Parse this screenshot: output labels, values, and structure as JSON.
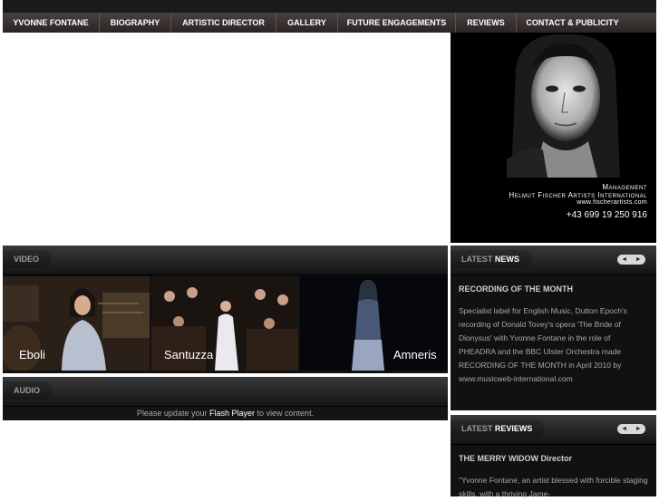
{
  "nav": {
    "items": [
      "YVONNE FONTANE",
      "BIOGRAPHY",
      "ARTISTIC DIRECTOR",
      "GALLERY",
      "FUTURE ENGAGEMENTS",
      "REVIEWS",
      "CONTACT & PUBLICITY"
    ]
  },
  "management": {
    "label": "Management",
    "agency": "Helmut Fischer Artists International",
    "website": "www.fischerartists.com",
    "phone": "+43 699 19 250 916"
  },
  "video": {
    "tab": "VIDEO",
    "thumbs": [
      "Eboli",
      "Santuzza",
      "Amneris"
    ]
  },
  "audio": {
    "tab": "AUDIO",
    "msg_pre": "Please update your",
    "msg_link": "Flash Player",
    "msg_post": "to view content."
  },
  "news": {
    "tab_prefix": "LATEST",
    "tab_word": "NEWS",
    "title": "RECORDING OF THE MONTH",
    "body": "Specialist label for English Music, Dutton Epoch's recording of Donald Tovey's opera 'The Bride of Dionysus' with Yvonne Fontane in the role of PHEADRA and the BBC Ulster Orchestra made RECORDING OF THE MONTH in April 2010 by www.musicweb-international.com"
  },
  "reviews": {
    "tab_prefix": "LATEST",
    "tab_word": "REVIEWS",
    "title": "THE MERRY WIDOW Director",
    "body": "\"Yvonne Fontane, an artist blessed with forcible staging skills, with a thriving Jame-"
  },
  "arrows": {
    "prev": "◄",
    "next": "►"
  },
  "colors": {
    "nav": "#3a3232",
    "panel": "#111111",
    "accent": "#ffffff"
  }
}
